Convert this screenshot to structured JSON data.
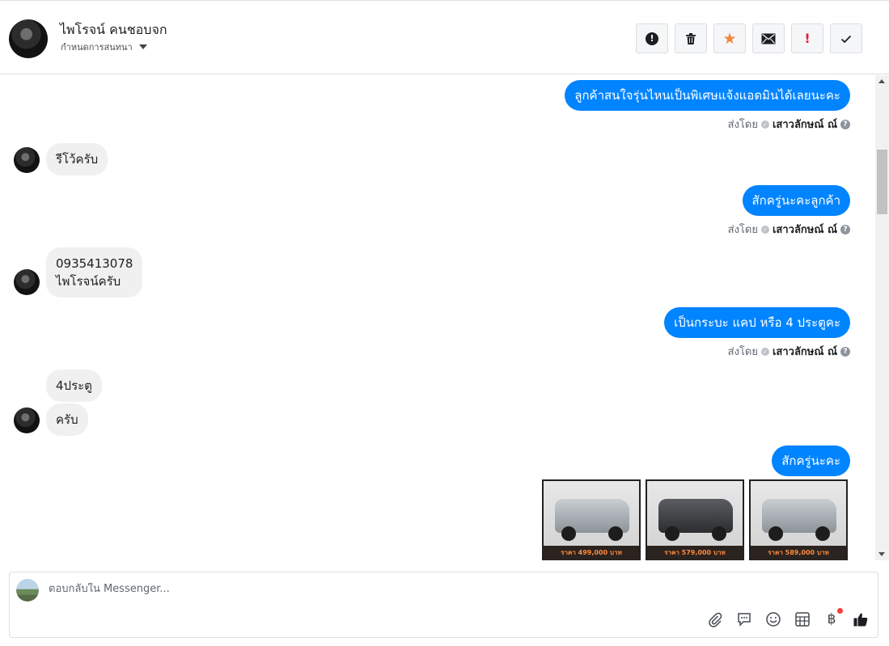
{
  "header": {
    "name": "ไพโรจน์ คนชอบจก",
    "subtitle": "กำหนดการสนทนา"
  },
  "messages": {
    "out_1": "ลูกค้าสนใจรุ่นไหนเป็นพิเศษแจ้งแอดมินได้เลยนะคะ",
    "in_1": "รีโว้ครับ",
    "out_2": "สักครู่นะคะลูกค้า",
    "in_2_line1": "0935413078",
    "in_2_line2": "ไพโรจน์ครับ",
    "out_3": "เป็นกระบะ แคป หรือ 4 ประตูคะ",
    "in_3": "4ประตู",
    "in_4": "ครับ",
    "out_4": "สักครู่นะคะ"
  },
  "sent_by": {
    "label": "ส่งโดย",
    "agent": "เสาวลักษณ์ ณ์"
  },
  "photos": [
    {
      "price": "ราคา 499,000 บาท",
      "color": "silver"
    },
    {
      "price": "ราคา 579,000 บาท",
      "color": "dark"
    },
    {
      "price": "ราคา 589,000 บาท",
      "color": "silver"
    }
  ],
  "composer": {
    "placeholder": "ตอบกลับใน Messenger..."
  },
  "colors": {
    "outgoing_bubble": "#0084ff",
    "incoming_bubble": "#f1f0f0",
    "star": "#f0883e",
    "alert": "#e41e3f"
  },
  "icons": {
    "actions": [
      "spam-alert-icon",
      "trash-icon",
      "star-icon",
      "envelope-icon",
      "exclamation-icon",
      "checkmark-icon"
    ],
    "composer_tools": [
      "paperclip-icon",
      "saved-reply-icon",
      "emoji-icon",
      "table-icon",
      "baht-icon",
      "thumbs-up-icon"
    ]
  }
}
